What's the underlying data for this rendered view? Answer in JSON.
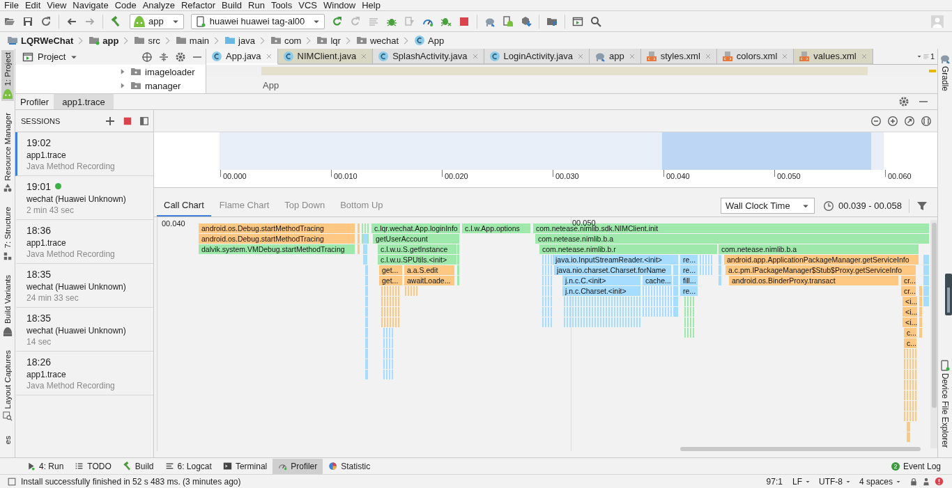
{
  "menu": [
    "File",
    "Edit",
    "View",
    "Navigate",
    "Code",
    "Analyze",
    "Refactor",
    "Build",
    "Run",
    "Tools",
    "VCS",
    "Window",
    "Help"
  ],
  "toolbar": {
    "run_config": "app",
    "device": "huawei huawei tag-al00"
  },
  "breadcrumb": [
    {
      "label": "LQRWeChat",
      "kind": "project"
    },
    {
      "label": "app",
      "kind": "module"
    },
    {
      "label": "src",
      "kind": "folder"
    },
    {
      "label": "main",
      "kind": "folder"
    },
    {
      "label": "java",
      "kind": "source"
    },
    {
      "label": "com",
      "kind": "package"
    },
    {
      "label": "lqr",
      "kind": "package"
    },
    {
      "label": "wechat",
      "kind": "package"
    },
    {
      "label": "App",
      "kind": "class"
    }
  ],
  "left_strip": [
    {
      "label": "1: Project",
      "selected": true
    },
    {
      "label": "Resource Manager",
      "selected": false
    },
    {
      "label": "7: Structure",
      "selected": false
    },
    {
      "label": "Build Variants",
      "selected": false
    },
    {
      "label": "Layout Captures",
      "selected": false
    },
    {
      "label": "es",
      "selected": false
    }
  ],
  "right_strip": [
    {
      "label": "Gradle"
    },
    {
      "label": "Device File Explorer"
    }
  ],
  "project_panel": {
    "title": "Project",
    "tree": [
      {
        "label": "imageloader",
        "expanded": false
      },
      {
        "label": "manager",
        "expanded": false
      }
    ]
  },
  "editor_tabs": [
    {
      "label": "App.java",
      "kind": "class",
      "selected": true,
      "color": "#f4f4f4"
    },
    {
      "label": "NIMClient.java",
      "kind": "class",
      "selected": false,
      "color": "#d8d7c4"
    },
    {
      "label": "SplashActivity.java",
      "kind": "class",
      "selected": false,
      "color": "#e0e0e0"
    },
    {
      "label": "LoginActivity.java",
      "kind": "class",
      "selected": false,
      "color": "#e0e0e0"
    },
    {
      "label": "app",
      "kind": "gradle",
      "selected": false,
      "color": "#e0e0e0"
    },
    {
      "label": "styles.xml",
      "kind": "xml",
      "selected": false,
      "color": "#e0e0e0"
    },
    {
      "label": "colors.xml",
      "kind": "xml",
      "selected": false,
      "color": "#e0e0e0"
    },
    {
      "label": "values.xml",
      "kind": "xml",
      "selected": false,
      "color": "#d8d7c4"
    }
  ],
  "editor": {
    "hidden_tabs": "1",
    "crumb": "App"
  },
  "profiler_tabs": [
    {
      "label": "Profiler",
      "selected": false
    },
    {
      "label": "app1.trace",
      "selected": true
    }
  ],
  "sessions": {
    "title": "SESSIONS",
    "items": [
      {
        "time": "19:02",
        "name": "app1.trace",
        "detail": "Java Method Recording",
        "selected": true,
        "live": false
      },
      {
        "time": "19:01",
        "name": "wechat (Huawei Unknown)",
        "detail": "2 min 43 sec",
        "selected": false,
        "live": true
      },
      {
        "time": "18:36",
        "name": "app1.trace",
        "detail": "Java Method Recording",
        "selected": false,
        "live": false
      },
      {
        "time": "18:35",
        "name": "wechat (Huawei Unknown)",
        "detail": "24 min 33 sec",
        "selected": false,
        "live": false
      },
      {
        "time": "18:35",
        "name": "wechat (Huawei Unknown)",
        "detail": "14 sec",
        "selected": false,
        "live": false
      },
      {
        "time": "18:26",
        "name": "app1.trace",
        "detail": "Java Method Recording",
        "selected": false,
        "live": false
      }
    ]
  },
  "timeline": {
    "ticks": [
      "00.000",
      "00.010",
      "00.020",
      "00.030",
      "00.040",
      "00.050",
      "00.060"
    ]
  },
  "analysis_tabs": [
    {
      "label": "Call Chart",
      "selected": true
    },
    {
      "label": "Flame Chart",
      "selected": false
    },
    {
      "label": "Top Down",
      "selected": false
    },
    {
      "label": "Bottom Up",
      "selected": false
    }
  ],
  "clock_mode": "Wall Clock Time",
  "range": "00.039 - 00.058",
  "call_chart": {
    "time_labels": [
      "00.040",
      "00.050"
    ],
    "bars": [
      {
        "label": "android.os.Debug.startMethodTracing",
        "color": "#ffc882"
      },
      {
        "label": "c.lqr.wechat.App.loginInfo",
        "color": "#9fe8ac"
      },
      {
        "label": "c.l.w.App.options",
        "color": "#9fe8ac"
      },
      {
        "label": "com.netease.nimlib.sdk.NIMClient.init",
        "color": "#9fe8ac"
      },
      {
        "label": "android.os.Debug.startMethodTracing",
        "color": "#ffc882"
      },
      {
        "label": "getUserAccount",
        "color": "#9fe8ac"
      },
      {
        "label": "com.netease.nimlib.b.a",
        "color": "#9fe8ac"
      },
      {
        "label": "dalvik.system.VMDebug.startMethodTracing",
        "color": "#9fe8ac"
      },
      {
        "label": "c.l.w.u.S.getInstance",
        "color": "#9fe8ac"
      },
      {
        "label": "com.netease.nimlib.b.r",
        "color": "#9fe8ac"
      },
      {
        "label": "com.netease.nimlib.b.a",
        "color": "#9fe8ac"
      },
      {
        "label": "c.l.w.u.SPUtils.<init>",
        "color": "#9fe8ac"
      },
      {
        "label": "java.io.InputStreamReader.<init>",
        "color": "#a6dcfd"
      },
      {
        "label": "re...",
        "color": "#a6dcfd"
      },
      {
        "label": "android.app.ApplicationPackageManager.getServiceInfo",
        "color": "#ffc882"
      },
      {
        "label": "get...",
        "color": "#ffc882"
      },
      {
        "label": "a.a.S.edit",
        "color": "#ffc882"
      },
      {
        "label": "java.nio.charset.Charset.forName",
        "color": "#a6dcfd"
      },
      {
        "label": "re...",
        "color": "#a6dcfd"
      },
      {
        "label": "a.c.pm.IPackageManager$Stub$Proxy.getServiceInfo",
        "color": "#ffc882"
      },
      {
        "label": "get...",
        "color": "#ffc882"
      },
      {
        "label": "awaitLoade...",
        "color": "#ffc882"
      },
      {
        "label": "j.n.c.C.<init>",
        "color": "#a6dcfd"
      },
      {
        "label": "cache...",
        "color": "#a6dcfd"
      },
      {
        "label": "fill...",
        "color": "#a6dcfd"
      },
      {
        "label": "android.os.BinderProxy.transact",
        "color": "#ffc882"
      },
      {
        "label": "cr...",
        "color": "#ffc882"
      },
      {
        "label": "j.n.c.Charset.<init>",
        "color": "#a6dcfd"
      },
      {
        "label": "re...",
        "color": "#a6dcfd"
      },
      {
        "label": "cr...",
        "color": "#ffc882"
      },
      {
        "label": "<i...",
        "color": "#ffc882"
      },
      {
        "label": "<i...",
        "color": "#ffc882"
      },
      {
        "label": "<i...",
        "color": "#ffc882"
      },
      {
        "label": "c...",
        "color": "#ffc882"
      },
      {
        "label": "c...",
        "color": "#ffc882"
      }
    ]
  },
  "bottom_tools": [
    {
      "label": "4: Run",
      "selected": false
    },
    {
      "label": "TODO",
      "selected": false
    },
    {
      "label": "Build",
      "selected": false
    },
    {
      "label": "6: Logcat",
      "selected": false
    },
    {
      "label": "Terminal",
      "selected": false
    },
    {
      "label": "Profiler",
      "selected": true
    },
    {
      "label": "Statistic",
      "selected": false
    }
  ],
  "event_log": {
    "count": "2",
    "label": "Event Log"
  },
  "status": {
    "message": "Install successfully finished in 52 s 483 ms. (3 minutes ago)",
    "position": "97:1",
    "line_separator": "LF",
    "encoding": "UTF-8",
    "indent": "4 spaces"
  }
}
